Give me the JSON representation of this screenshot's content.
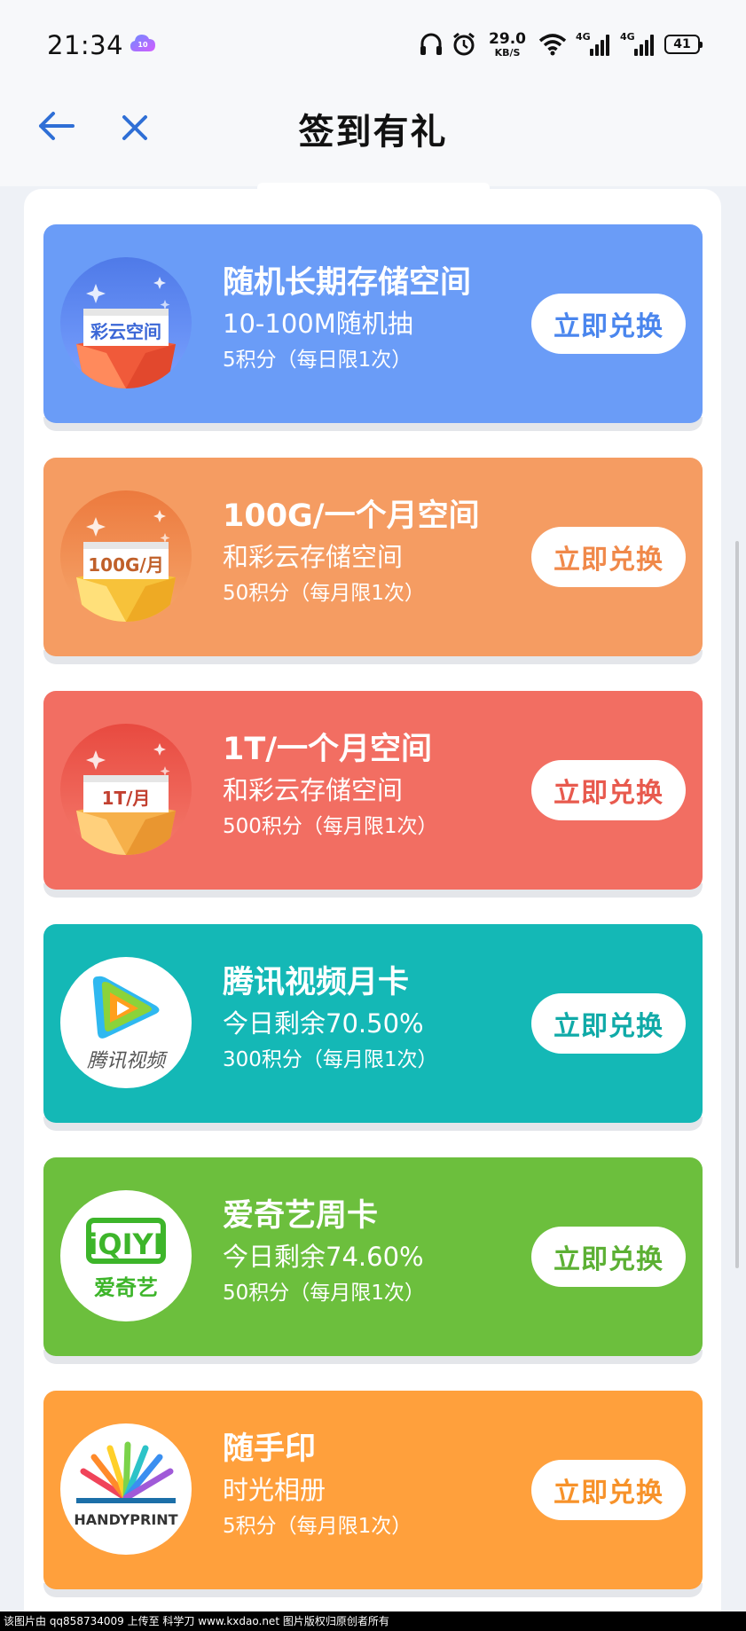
{
  "status_bar": {
    "time": "21:34",
    "net_speed_value": "29.0",
    "net_speed_unit": "KB/S",
    "signal1_label": "4G",
    "signal2_label": "4G",
    "battery": "41"
  },
  "header": {
    "title": "签到有礼"
  },
  "cards": [
    {
      "title": "随机长期存储空间",
      "subtitle": "10-100M随机抽",
      "points": "5积分（每日限1次）",
      "button": "立即兑换",
      "icon_label": "彩云空间",
      "bg": "#6a9cf7",
      "btn_color": "#4a86ee"
    },
    {
      "title": "100G/一个月空间",
      "subtitle": "和彩云存储空间",
      "points": "50积分（每月限1次）",
      "button": "立即兑换",
      "icon_label": "100G/月",
      "bg": "#f59c62",
      "btn_color": "#f0894a"
    },
    {
      "title": "1T/一个月空间",
      "subtitle": "和彩云存储空间",
      "points": "500积分（每月限1次）",
      "button": "立即兑换",
      "icon_label": "1T/月",
      "bg": "#f26e62",
      "btn_color": "#e85a4e"
    },
    {
      "title": "腾讯视频月卡",
      "subtitle": "今日剩余70.50%",
      "points": "300积分（每月限1次）",
      "button": "立即兑换",
      "icon_label": "腾讯视频",
      "bg": "#14b8b6",
      "btn_color": "#10aaa8"
    },
    {
      "title": "爱奇艺周卡",
      "subtitle": "今日剩余74.60%",
      "points": "50积分（每月限1次）",
      "button": "立即兑换",
      "icon_label": "爱奇艺",
      "icon_logo": "iQIYI",
      "bg": "#6cbf3d",
      "btn_color": "#5cb034"
    },
    {
      "title": "随手印",
      "subtitle": "时光相册",
      "points": "5积分（每月限1次）",
      "button": "立即兑换",
      "icon_label": "HANDYPRINT",
      "bg": "#ffa03c",
      "btn_color": "#f7922a"
    }
  ],
  "watermark": "该图片由 qq858734009 上传至 科学刀 www.kxdao.net 图片版权归原创者所有"
}
